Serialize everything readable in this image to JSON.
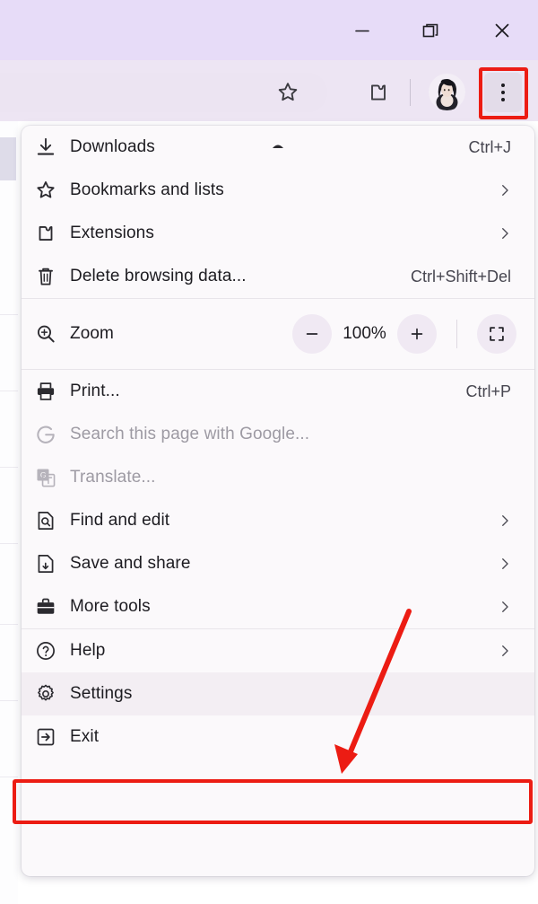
{
  "window": {
    "controls": [
      {
        "name": "minimize",
        "label": "Minimize"
      },
      {
        "name": "maximize",
        "label": "Restore Down"
      },
      {
        "name": "close",
        "label": "Close"
      }
    ],
    "titlebar_color": "#e7dcf8",
    "toolbar_color": "#ede5f3"
  },
  "toolbar": {
    "bookmark_star": "star-icon",
    "extensions": "extensions-puzzle-icon",
    "profile_avatar": "avatar",
    "more_button": "three-dot-menu-icon"
  },
  "menu": {
    "scroll_up_indicator": "chevron-up-icon",
    "sections": [
      {
        "items": [
          {
            "icon": "download-icon",
            "label": "Downloads",
            "accel": "Ctrl+J",
            "submenu": false,
            "disabled": false
          },
          {
            "icon": "star-icon",
            "label": "Bookmarks and lists",
            "accel": "",
            "submenu": true,
            "disabled": false
          },
          {
            "icon": "puzzle-icon",
            "label": "Extensions",
            "accel": "",
            "submenu": true,
            "disabled": false
          },
          {
            "icon": "trash-icon",
            "label": "Delete browsing data...",
            "accel": "Ctrl+Shift+Del",
            "submenu": false,
            "disabled": false
          }
        ]
      },
      {
        "zoom_row": {
          "icon": "zoom-magnifier-icon",
          "label": "Zoom",
          "minus_label": "−",
          "level": "100%",
          "plus_label": "+",
          "fullscreen": "fullscreen-icon"
        }
      },
      {
        "items": [
          {
            "icon": "printer-icon",
            "label": "Print...",
            "accel": "Ctrl+P",
            "submenu": false,
            "disabled": false
          },
          {
            "icon": "google-g-icon",
            "label": "Search this page with Google...",
            "accel": "",
            "submenu": false,
            "disabled": true
          },
          {
            "icon": "translate-icon",
            "label": "Translate...",
            "accel": "",
            "submenu": false,
            "disabled": true
          },
          {
            "icon": "find-edit-icon",
            "label": "Find and edit",
            "accel": "",
            "submenu": true,
            "disabled": false
          },
          {
            "icon": "save-share-icon",
            "label": "Save and share",
            "accel": "",
            "submenu": true,
            "disabled": false
          },
          {
            "icon": "toolbox-icon",
            "label": "More tools",
            "accel": "",
            "submenu": true,
            "disabled": false
          }
        ]
      },
      {
        "items": [
          {
            "icon": "help-circle-icon",
            "label": "Help",
            "accel": "",
            "submenu": true,
            "disabled": false,
            "highlight": false
          },
          {
            "icon": "gear-icon",
            "label": "Settings",
            "accel": "",
            "submenu": false,
            "disabled": false,
            "highlight": true
          },
          {
            "icon": "exit-icon",
            "label": "Exit",
            "accel": "",
            "submenu": false,
            "disabled": false,
            "highlight": false
          }
        ]
      }
    ]
  },
  "annotations": {
    "highlight_color": "#ec1c13",
    "boxes": [
      {
        "name": "three-dot-menu-highlight",
        "target": "more-button"
      },
      {
        "name": "settings-highlight",
        "target": "Settings"
      }
    ],
    "arrow": {
      "name": "pointer-arrow",
      "points_to": "Settings",
      "color": "#ec1c13"
    }
  }
}
